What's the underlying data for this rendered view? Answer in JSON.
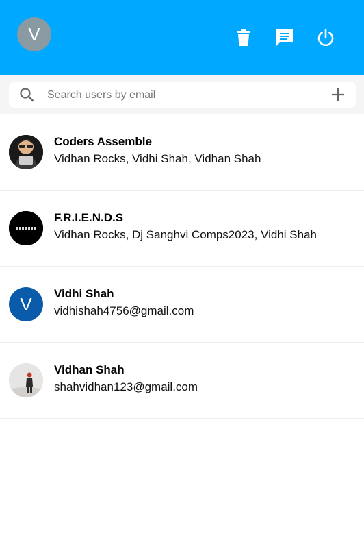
{
  "header": {
    "user_initial": "V",
    "background": "#00a8ff",
    "icons": [
      "delete-icon",
      "chat-icon",
      "power-icon"
    ]
  },
  "search": {
    "placeholder": "Search users by email",
    "value": ""
  },
  "conversations": [
    {
      "name": "Coders Assemble",
      "subtitle": "Vidhan Rocks, Vidhi Shah, Vidhan Shah",
      "avatar": "photo"
    },
    {
      "name": "F.R.I.E.N.D.S",
      "subtitle": "Vidhan Rocks, Dj Sanghvi Comps2023, Vidhi Shah",
      "avatar": "photo"
    },
    {
      "name": "Vidhi Shah",
      "subtitle": "vidhishah4756@gmail.com",
      "avatar_initial": "V",
      "avatar_color": "#0b5bab"
    },
    {
      "name": "Vidhan Shah",
      "subtitle": "shahvidhan123@gmail.com",
      "avatar": "photo"
    }
  ]
}
